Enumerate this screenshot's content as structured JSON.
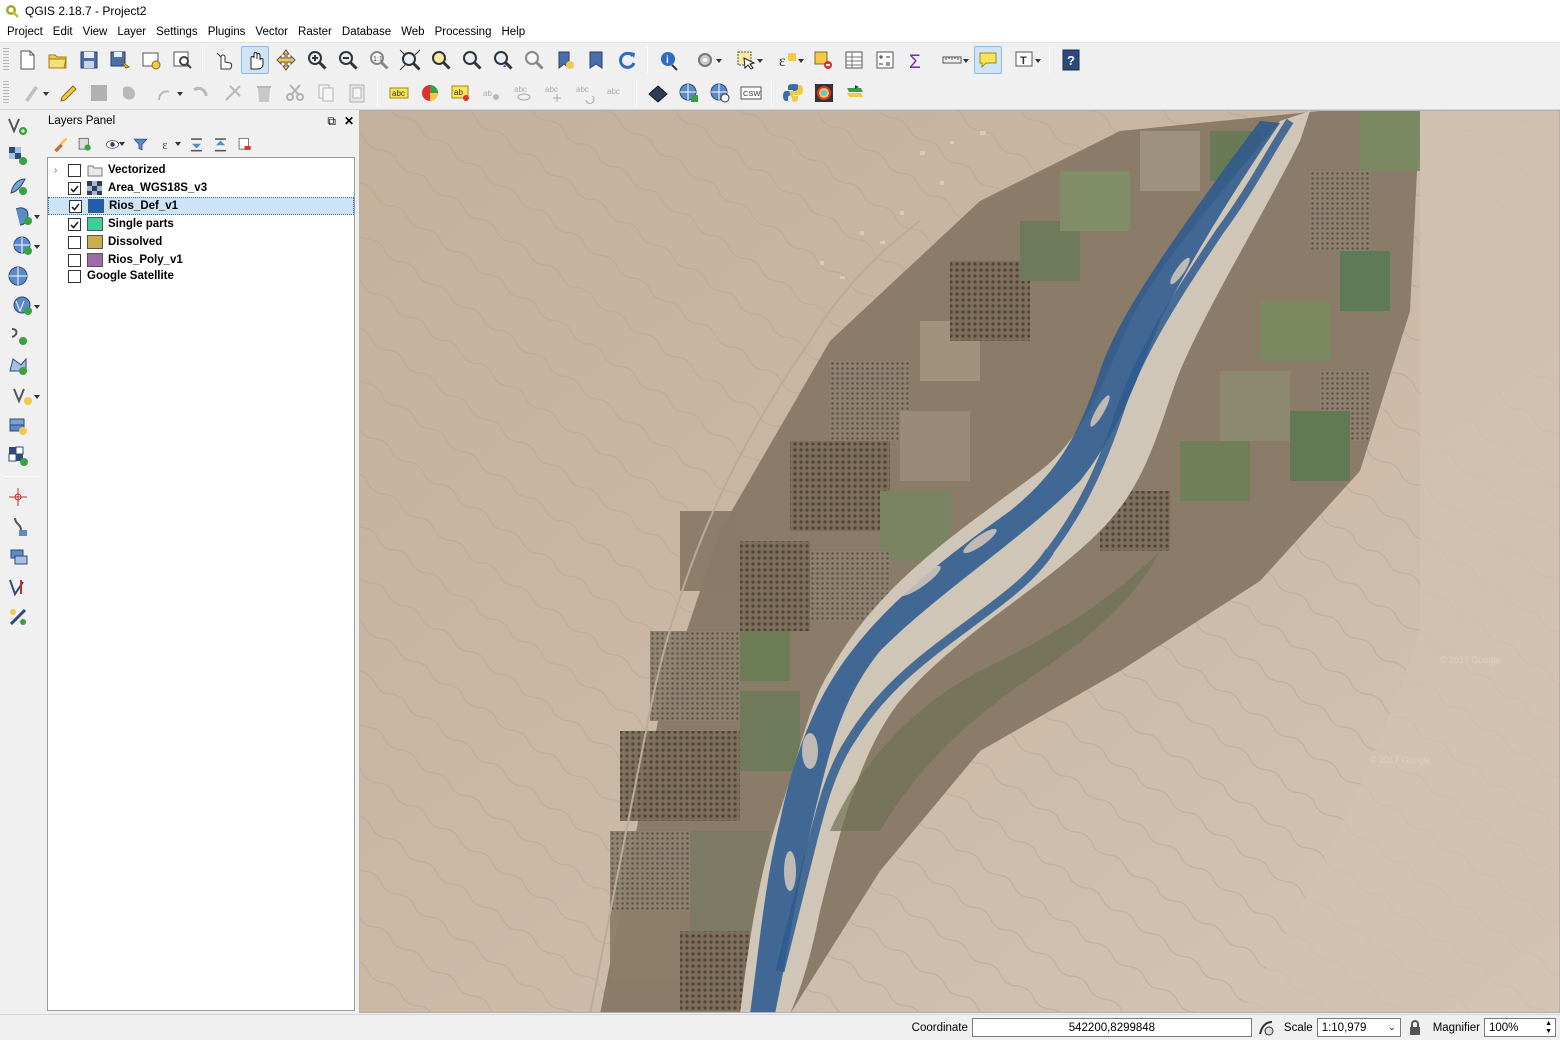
{
  "window": {
    "title": "QGIS 2.18.7 - Project2"
  },
  "menu": [
    "Project",
    "Edit",
    "View",
    "Layer",
    "Settings",
    "Plugins",
    "Vector",
    "Raster",
    "Database",
    "Web",
    "Processing",
    "Help"
  ],
  "layers_panel": {
    "title": "Layers Panel",
    "layers": [
      {
        "name": "Vectorized",
        "checked": false,
        "expandable": true,
        "swatch": "group",
        "selected": false
      },
      {
        "name": "Area_WGS18S_v3",
        "checked": true,
        "expandable": false,
        "swatch": "raster",
        "selected": false
      },
      {
        "name": "Rios_Def_v1",
        "checked": true,
        "expandable": false,
        "swatch": "#1f5fad",
        "selected": true
      },
      {
        "name": "Single parts",
        "checked": true,
        "expandable": false,
        "swatch": "#3ccf9a",
        "selected": false
      },
      {
        "name": "Dissolved",
        "checked": false,
        "expandable": false,
        "swatch": "#c9ae4a",
        "selected": false
      },
      {
        "name": "Rios_Poly_v1",
        "checked": false,
        "expandable": false,
        "swatch": "#9e6aa8",
        "selected": false
      },
      {
        "name": "Google Satellite",
        "checked": false,
        "expandable": false,
        "swatch": "none",
        "selected": false
      }
    ]
  },
  "status": {
    "coordinate_label": "Coordinate",
    "coordinate_value": "542200,8299848",
    "scale_label": "Scale",
    "scale_value": "1:10,979",
    "magnifier_label": "Magnifier",
    "magnifier_value": "100%"
  },
  "colors": {
    "river_fill": "#2e5a8e",
    "desert": "#c9b6a2",
    "selection": "#cde4f7"
  }
}
